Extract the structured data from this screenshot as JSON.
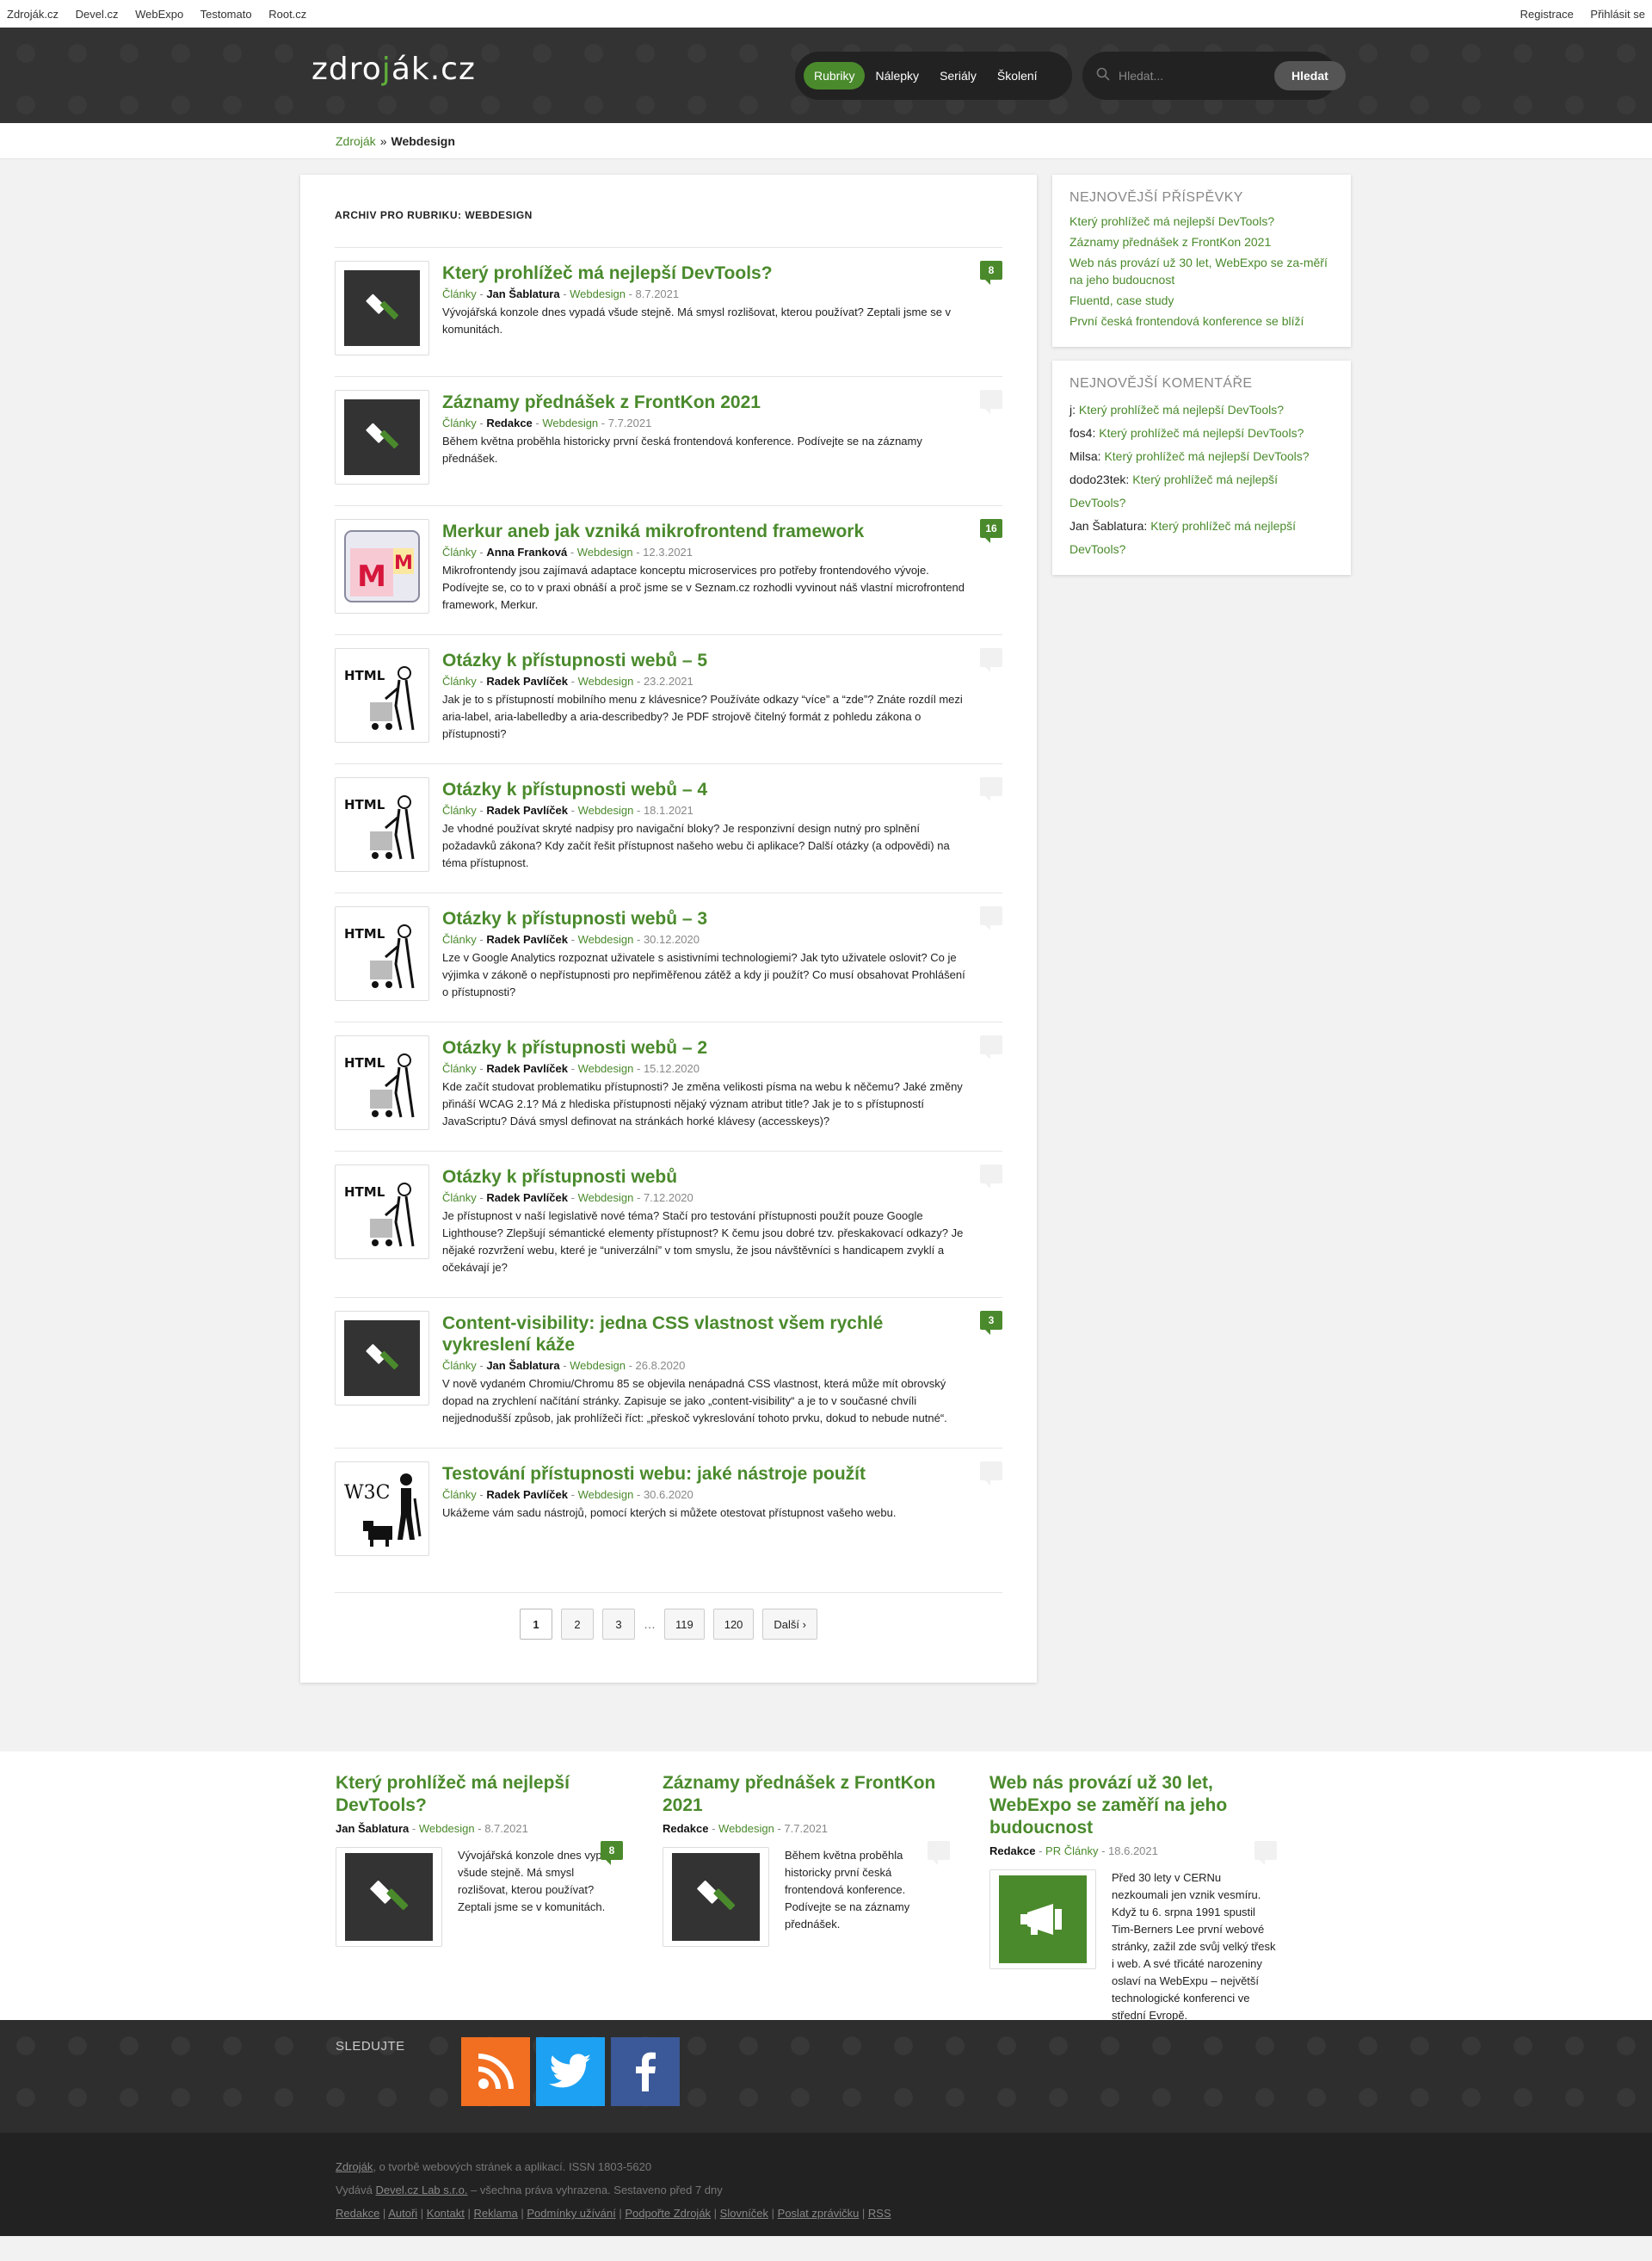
{
  "topbar": {
    "links": [
      "Zdroják.cz",
      "Devel.cz",
      "WebExpo",
      "Testomato",
      "Root.cz"
    ],
    "auth": [
      "Registrace",
      "Přihlásit se"
    ]
  },
  "header": {
    "logo_left": "zdro",
    "logo_j": "j",
    "logo_right": "ák.cz",
    "nav": [
      "Rubriky",
      "Nálepky",
      "Seriály",
      "Školení"
    ],
    "search_placeholder": "Hledat...",
    "search_button": "Hledat"
  },
  "breadcrumb": {
    "home": "Zdroják",
    "separator": "»",
    "current": "Webdesign"
  },
  "archive_title": "ARCHIV PRO RUBRIKU: WEBDESIGN",
  "articles": [
    {
      "title": "Který prohlížeč má nejlepší DevTools?",
      "category": "Články",
      "author": "Jan Šablatura",
      "tag": "Webdesign",
      "date": "8.7.2021",
      "excerpt": "Vývojářská konzole dnes vypadá všude stejně. Má smysl rozlišovat, kterou používat? Zeptali jsme se v komunitách.",
      "comments": "8",
      "thumb": "hammer-icon"
    },
    {
      "title": "Záznamy přednášek z FrontKon 2021",
      "category": "Články",
      "author": "Redakce",
      "tag": "Webdesign",
      "date": "7.7.2021",
      "excerpt": "Během května proběhla historicky první česká frontendová konference. Podívejte se na záznamy přednášek.",
      "comments": "0",
      "thumb": "hammer-icon"
    },
    {
      "title": "Merkur aneb jak vzniká mikrofrontend framework",
      "category": "Články",
      "author": "Anna Franková",
      "tag": "Webdesign",
      "date": "12.3.2021",
      "excerpt": "Mikrofrontendy jsou zajímavá adaptace konceptu microservices pro potřeby frontendového vývoje. Podívejte se, co to v praxi obnáší a proč jsme se v Seznam.cz rozhodli vyvinout náš vlastní microfrontend framework, Merkur.",
      "comments": "16",
      "thumb": "merkur-icon"
    },
    {
      "title": "Otázky k přístupnosti webů – 5",
      "category": "Články",
      "author": "Radek Pavlíček",
      "tag": "Webdesign",
      "date": "23.2.2021",
      "excerpt": "Jak je to s přístupností mobilního menu z klávesnice? Používáte odkazy “více” a “zde”? Znáte rozdíl mezi aria-label, aria-labelledby a aria-describedby? Je PDF strojově čitelný formát z pohledu zákona o přístupnosti?",
      "comments": "0",
      "thumb": "html-accessibility-icon"
    },
    {
      "title": "Otázky k přístupnosti webů – 4",
      "category": "Články",
      "author": "Radek Pavlíček",
      "tag": "Webdesign",
      "date": "18.1.2021",
      "excerpt": "Je vhodné používat skryté nadpisy pro navigační bloky? Je responzivní design nutný pro splnění požadavků zákona? Kdy začít řešit přístupnost našeho webu či aplikace? Další otázky (a odpovědi) na téma přístupnost.",
      "comments": "0",
      "thumb": "html-accessibility-icon"
    },
    {
      "title": "Otázky k přístupnosti webů – 3",
      "category": "Články",
      "author": "Radek Pavlíček",
      "tag": "Webdesign",
      "date": "30.12.2020",
      "excerpt": "Lze v Google Analytics rozpoznat uživatele s asistivními technologiemi? Jak tyto uživatele oslovit? Co je výjimka v zákoně o nepřístupnosti pro nepřiměřenou zátěž a kdy ji použít? Co musí obsahovat Prohlášení o přístupnosti?",
      "comments": "0",
      "thumb": "html-accessibility-icon"
    },
    {
      "title": "Otázky k přístupnosti webů – 2",
      "category": "Články",
      "author": "Radek Pavlíček",
      "tag": "Webdesign",
      "date": "15.12.2020",
      "excerpt": "Kde začít studovat problematiku přístupnosti? Je změna velikosti písma na webu k něčemu? Jaké změny přináší WCAG 2.1? Má z hlediska přístupnosti nějaký význam atribut title? Jak je to s přístupností JavaScriptu? Dává smysl definovat na stránkách horké klávesy (accesskeys)?",
      "comments": "0",
      "thumb": "html-accessibility-icon"
    },
    {
      "title": "Otázky k přístupnosti webů",
      "category": "Články",
      "author": "Radek Pavlíček",
      "tag": "Webdesign",
      "date": "7.12.2020",
      "excerpt": "Je přístupnost v naší legislativě nové téma? Stačí pro testování přístupnosti použít pouze Google Lighthouse? Zlepšují sémantické elementy přístupnost? K čemu jsou dobré tzv. přeskakovací odkazy? Je nějaké rozvržení webu, které je “univerzální” v tom smyslu, že jsou návštěvníci s handicapem zvyklí a očekávají je?",
      "comments": "0",
      "thumb": "html-accessibility-icon"
    },
    {
      "title": "Content-visibility: jedna CSS vlastnost všem rychlé vykreslení káže",
      "category": "Články",
      "author": "Jan Šablatura",
      "tag": "Webdesign",
      "date": "26.8.2020",
      "excerpt": "V nově vydaném Chromiu/Chromu 85 se objevila nenápadná CSS vlastnost, která může mít obrovský dopad na zrychlení načítání stránky. Zapisuje se jako „content-visibility“ a je to v současné chvíli nejjednodušší způsob, jak prohlížeči říct: „přeskoč vykreslování tohoto prvku, dokud to nebude nutné“.",
      "comments": "3",
      "thumb": "hammer-icon"
    },
    {
      "title": "Testování přístupnosti webu: jaké nástroje použít",
      "category": "Články",
      "author": "Radek Pavlíček",
      "tag": "Webdesign",
      "date": "30.6.2020",
      "excerpt": "Ukážeme vám sadu nástrojů, pomocí kterých si můžete otestovat přístupnost vašeho webu.",
      "comments": "0",
      "thumb": "w3c-accessibility-icon"
    }
  ],
  "pagination": {
    "pages": [
      "1",
      "2",
      "3"
    ],
    "ellipsis": "…",
    "last_pages": [
      "119",
      "120"
    ],
    "next": "Další",
    "current": "1"
  },
  "sidebar": {
    "latest_title": "NEJNOVĚJŠÍ PŘÍSPĚVKY",
    "latest": [
      "Který prohlížeč má nejlepší DevTools?",
      "Záznamy přednášek z FrontKon 2021",
      "Web nás provází už 30 let, WebExpo se za-měří na jeho budoucnost",
      "Fluentd, case study",
      "První česká frontendová konference se blíží"
    ],
    "comments_title": "NEJNOVĚJŠÍ KOMENTÁŘE",
    "comments": [
      {
        "author": "j",
        "post": "Který prohlížeč má nejlepší DevTools?"
      },
      {
        "author": "fos4",
        "post": "Který prohlížeč má nejlepší DevTools?"
      },
      {
        "author": "Milsa",
        "post": "Který prohlížeč má nejlepší DevTools?"
      },
      {
        "author": "dodo23tek",
        "post": "Který prohlížeč má nejlepší DevTools?"
      },
      {
        "author": "Jan Šablatura",
        "post": "Který prohlížeč má nejlepší DevTools?"
      }
    ]
  },
  "featured": [
    {
      "title": "Který prohlížeč má nejlepší DevTools?",
      "author": "Jan Šablatura",
      "tag": "Webdesign",
      "date": "8.7.2021",
      "comments": "8",
      "excerpt": "Vývojářská konzole dnes vypadá všude stejně. Má smysl rozlišovat, kterou používat? Zeptali jsme se v komunitách.",
      "thumb": "hammer-icon"
    },
    {
      "title": "Záznamy přednášek z FrontKon 2021",
      "author": "Redakce",
      "tag": "Webdesign",
      "date": "7.7.2021",
      "comments": "0",
      "excerpt": "Během května proběhla historicky první česká frontendová konference. Podívejte se na záznamy přednášek.",
      "thumb": "hammer-icon"
    },
    {
      "title": "Web nás provází už 30 let, WebExpo se zaměří na jeho budoucnost",
      "author": "Redakce",
      "tag": "PR Články",
      "date": "18.6.2021",
      "comments": "0",
      "excerpt": "Před 30 lety v CERNu nezkoumali jen vznik vesmíru. Když tu 6. srpna 1991 spustil Tim-Berners Lee první webové stránky, zažil zde svůj velký třesk i web. A své třicáté narozeniny oslaví na WebExpu – největší technologické konferenci ve střední Evropě.",
      "thumb": "megaphone-icon"
    }
  ],
  "follow": {
    "label": "SLEDUJTE",
    "icons": [
      "rss-icon",
      "twitter-icon",
      "facebook-icon"
    ]
  },
  "footer": {
    "line1_link": "Zdroják",
    "line1_rest": ", o tvorbě webových stránek a aplikací. ISSN 1803-5620",
    "line2_pre": "Vydává ",
    "line2_link": "Devel.cz Lab s.r.o.",
    "line2_rest": " – všechna práva vyhrazena. Sestaveno před 7 dny",
    "links": [
      "Redakce",
      "Autoři",
      "Kontakt",
      "Reklama",
      "Podmínky užívání",
      "Podpořte Zdroják",
      "Slovníček",
      "Poslat zprávičku",
      "RSS"
    ]
  },
  "colors": {
    "accent": "#4a8a2c",
    "header_bg": "#333333",
    "footer_bg": "#222222"
  }
}
